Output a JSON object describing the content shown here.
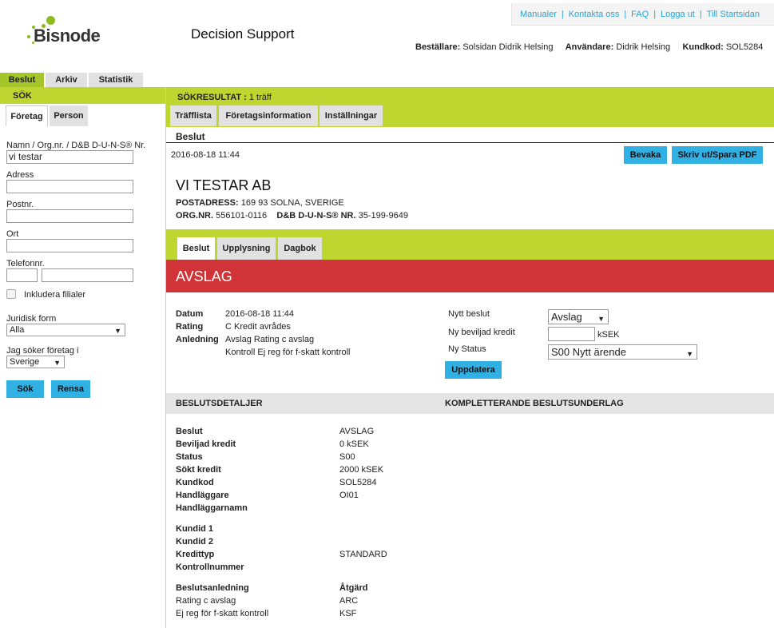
{
  "header": {
    "links": [
      "Manualer",
      "Kontakta oss",
      "FAQ",
      "Logga ut",
      "Till Startsidan"
    ],
    "logo_text": "Bisnode",
    "app_title": "Decision Support",
    "orderer_label": "Beställare:",
    "orderer": "Solsidan Didrik Helsing",
    "user_label": "Användare:",
    "user": "Didrik Helsing",
    "customer_code_label": "Kundkod:",
    "customer_code": "SOL5284"
  },
  "main_tabs": [
    "Beslut",
    "Arkiv",
    "Statistik"
  ],
  "search": {
    "heading": "SÖK",
    "tabs": [
      "Företag",
      "Person"
    ],
    "name_label": "Namn / Org.nr. / D&B D-U-N-S® Nr.",
    "name_value": "vi testar",
    "address_label": "Adress",
    "postal_label": "Postnr.",
    "city_label": "Ort",
    "phone_label": "Telefonnr.",
    "include_branches_label": "Inkludera filialer",
    "legal_form_label": "Juridisk form",
    "legal_form_value": "Alla",
    "country_label": "Jag söker företag i",
    "country_value": "Sverige",
    "search_button": "Sök",
    "clear_button": "Rensa"
  },
  "results": {
    "label": "SÖKRESULTAT :",
    "count": "1 träff",
    "tabs": [
      "Träfflista",
      "Företagsinformation",
      "Inställningar"
    ]
  },
  "decision": {
    "heading": "Beslut",
    "timestamp": "2016-08-18 11:44",
    "watch_button": "Bevaka",
    "print_button": "Skriv ut/Spara PDF",
    "company_name": "VI TESTAR AB",
    "postal_label": "POSTADRESS:",
    "postal_value": "169 93 SOLNA, SVERIGE",
    "orgnr_label": "ORG.NR.",
    "orgnr_value": "556101-0116",
    "duns_label": "D&B D-U-N-S® NR.",
    "duns_value": "35-199-9649",
    "tabs": [
      "Beslut",
      "Upplysning",
      "Dagbok"
    ],
    "result": "AVSLAG",
    "date_label": "Datum",
    "date_value": "2016-08-18 11:44",
    "rating_label": "Rating",
    "rating_value": "C Kredit avrådes",
    "reason_label": "Anledning",
    "reason_1": "Avslag Rating c avslag",
    "reason_2": "Kontroll Ej reg för f-skatt kontroll",
    "new_decision_label": "Nytt beslut",
    "new_decision_value": "Avslag",
    "new_credit_label": "Ny beviljad kredit",
    "new_credit_value": "",
    "new_credit_unit": "kSEK",
    "new_status_label": "Ny Status",
    "new_status_value": "S00 Nytt ärende",
    "update_button": "Uppdatera"
  },
  "details": {
    "heading_left": "BESLUTSDETALJER",
    "heading_right": "KOMPLETTERANDE BESLUTSUNDERLAG",
    "rows": [
      {
        "label": "Beslut",
        "value": "AVSLAG"
      },
      {
        "label": "Beviljad kredit",
        "value": "0 kSEK"
      },
      {
        "label": "Status",
        "value": "S00"
      },
      {
        "label": "Sökt kredit",
        "value": "2000 kSEK"
      },
      {
        "label": "Kundkod",
        "value": "SOL5284"
      },
      {
        "label": "Handläggare",
        "value": "OI01"
      },
      {
        "label": "Handläggarnamn",
        "value": ""
      }
    ],
    "rows2": [
      {
        "label": "Kundid 1",
        "value": ""
      },
      {
        "label": "Kundid 2",
        "value": ""
      },
      {
        "label": "Kredittyp",
        "value": "STANDARD"
      },
      {
        "label": "Kontrollnummer",
        "value": ""
      }
    ],
    "reason_header": "Beslutsanledning",
    "action_header": "Åtgärd",
    "reasons": [
      {
        "reason": "Rating c avslag",
        "action": "ARC"
      },
      {
        "reason": "Ej reg för f-skatt kontroll",
        "action": "KSF"
      }
    ]
  }
}
